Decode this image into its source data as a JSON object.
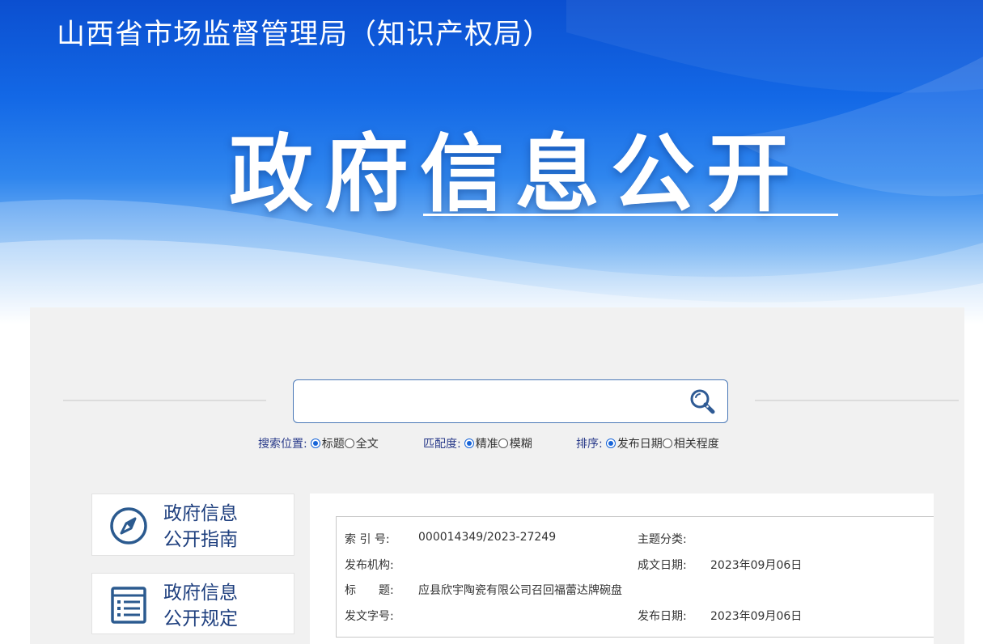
{
  "header": {
    "site_title": "山西省市场监督管理局（知识产权局）",
    "hero_title": "政府信息公开"
  },
  "search": {
    "placeholder": "",
    "button_icon": "search-icon",
    "position": {
      "label": "搜索位置:",
      "options": [
        "标题",
        "全文"
      ],
      "selected": "标题"
    },
    "match": {
      "label": "匹配度:",
      "options": [
        "精准",
        "模糊"
      ],
      "selected": "精准"
    },
    "sort": {
      "label": "排序:",
      "options": [
        "发布日期",
        "相关程度"
      ],
      "selected": "发布日期"
    }
  },
  "nav": {
    "items": [
      {
        "line1": "政府信息",
        "line2": "公开指南",
        "icon": "compass-icon"
      },
      {
        "line1": "政府信息",
        "line2": "公开规定",
        "icon": "list-icon"
      }
    ]
  },
  "info": {
    "index_label": "索 引 号:",
    "index_value": "000014349/2023-27249",
    "topic_label": "主题分类:",
    "topic_value": "",
    "agency_label": "发布机构:",
    "agency_value": "",
    "created_label": "成文日期:",
    "created_value": "2023年09月06日",
    "title_label": "标　　题:",
    "title_value": "应县欣宇陶瓷有限公司召回福蕾达牌碗盘",
    "docno_label": "发文字号:",
    "docno_value": "",
    "published_label": "发布日期:",
    "published_value": "2023年09月06日"
  },
  "colors": {
    "banner_blue": "#1368e6",
    "nav_text": "#1e3f7e",
    "option_label": "#2a3b8a",
    "panel_bg": "#f1f1f1"
  }
}
